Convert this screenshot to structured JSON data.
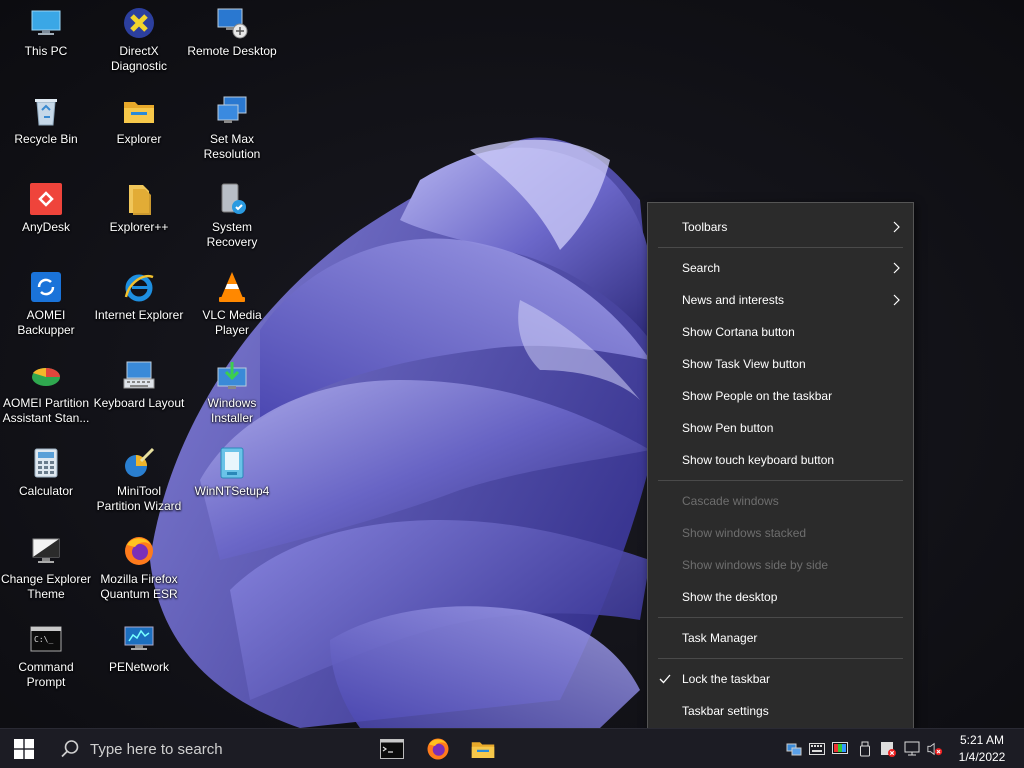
{
  "desktop": {
    "icons": [
      {
        "label": "This PC",
        "icon": "monitor-icon"
      },
      {
        "label": "DirectX\nDiagnostic",
        "icon": "directx-icon"
      },
      {
        "label": "Remote Desktop",
        "icon": "remote-desktop-icon"
      },
      {
        "label": "Recycle Bin",
        "icon": "recycle-bin-icon"
      },
      {
        "label": "Explorer",
        "icon": "folder-icon"
      },
      {
        "label": "Set Max\nResolution",
        "icon": "display-settings-icon"
      },
      {
        "label": "AnyDesk",
        "icon": "anydesk-icon"
      },
      {
        "label": "Explorer++",
        "icon": "folder-plus-icon"
      },
      {
        "label": "System Recovery",
        "icon": "system-recovery-icon"
      },
      {
        "label": "AOMEI\nBackupper",
        "icon": "aomei-backupper-icon"
      },
      {
        "label": "Internet Explorer",
        "icon": "internet-explorer-icon"
      },
      {
        "label": "VLC Media\nPlayer",
        "icon": "vlc-cone-icon"
      },
      {
        "label": "AOMEI Partition\nAssistant Stan...",
        "icon": "partition-assistant-icon"
      },
      {
        "label": "Keyboard Layout",
        "icon": "keyboard-layout-icon"
      },
      {
        "label": "Windows\nInstaller",
        "icon": "windows-installer-icon"
      },
      {
        "label": "Calculator",
        "icon": "calculator-icon"
      },
      {
        "label": "MiniTool\nPartition Wizard",
        "icon": "minitool-wizard-icon"
      },
      {
        "label": "WinNTSetup4",
        "icon": "winntsetup-icon"
      },
      {
        "label": "Change Explorer\nTheme",
        "icon": "theme-monitor-icon"
      },
      {
        "label": "Mozilla Firefox\nQuantum ESR",
        "icon": "firefox-icon"
      },
      {
        "label": "Command\nPrompt",
        "icon": "command-prompt-icon"
      },
      {
        "label": "PENetwork",
        "icon": "network-icon"
      }
    ]
  },
  "context_menu": {
    "toolbars": "Toolbars",
    "search": "Search",
    "news": "News and interests",
    "cortana": "Show Cortana button",
    "task_view": "Show Task View button",
    "people": "Show People on the taskbar",
    "pen": "Show Pen button",
    "touch_keyboard": "Show touch keyboard button",
    "cascade": "Cascade windows",
    "stacked": "Show windows stacked",
    "side_by_side": "Show windows side by side",
    "show_desktop": "Show the desktop",
    "task_manager": "Task Manager",
    "lock_taskbar": "Lock the taskbar",
    "taskbar_settings": "Taskbar settings"
  },
  "taskbar": {
    "search_placeholder": "Type here to search",
    "clock_time": "5:21 AM",
    "clock_date": "1/4/2022",
    "pinned": [
      "command-prompt-icon",
      "firefox-icon",
      "file-explorer-icon"
    ]
  },
  "colors": {
    "menu_bg": "#2b2b2b",
    "taskbar_bg": "#1c1c24",
    "disabled_text": "#6e6e6e",
    "accent": "#0078d4"
  }
}
